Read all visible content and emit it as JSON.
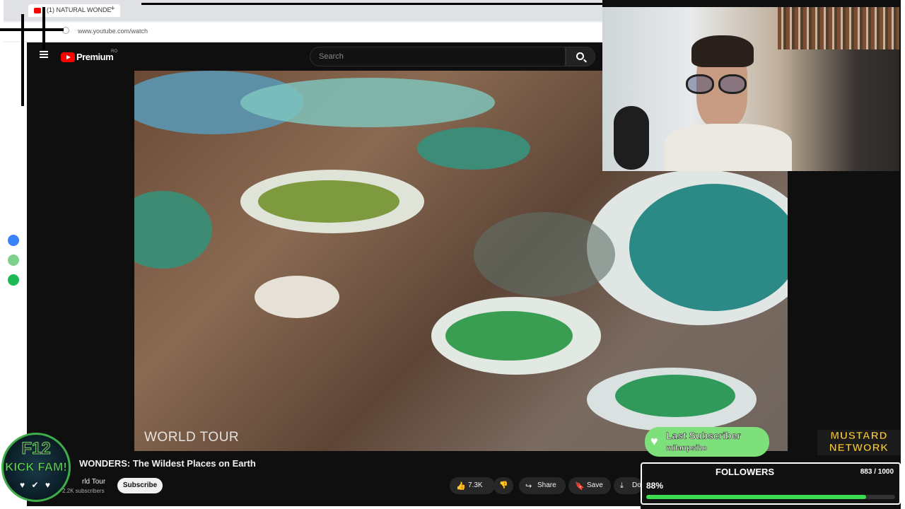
{
  "browser": {
    "tab_title": "(1) NATURAL WONDE",
    "new_tab": "+",
    "url": "www.youtube.com/watch"
  },
  "youtube": {
    "logo_text": "Premium",
    "logo_region": "RO",
    "search_placeholder": "Search"
  },
  "video": {
    "caption": "WORLD TOUR",
    "title": "WONDERS: The Wildest Places on Earth",
    "channel": "rld Tour",
    "subscribers": "2.2K subscribers",
    "subscribe_label": "Subscribe",
    "like_count": "7.3K",
    "share_label": "Share",
    "save_label": "Save",
    "download_label": "Do"
  },
  "overlay": {
    "last_subscriber_label": "Last Subscriber",
    "last_subscriber_name": "milanpsiho",
    "network_line1": "MUSTARD",
    "network_line2": "NETWORK",
    "followers_label": "FOLLOWERS",
    "followers_count": "883 / 1000",
    "followers_percent_text": "88%",
    "followers_progress": 0.883,
    "badge_line1": "F12",
    "badge_line2": "KICK FAM!",
    "badge_icons": "♥ ✔ ♥"
  },
  "icons": [
    "menu-icon",
    "youtube-logo-icon",
    "search-icon",
    "like-icon",
    "dislike-icon",
    "share-icon",
    "save-icon",
    "download-icon",
    "heart-icon",
    "messenger-icon",
    "whatsapp-icon",
    "spotify-icon"
  ],
  "colors": {
    "youtube_red": "#ff0000",
    "progress_green": "#3ddc50",
    "subscriber_green": "#7ee07a",
    "network_yellow": "#f3c93a"
  }
}
